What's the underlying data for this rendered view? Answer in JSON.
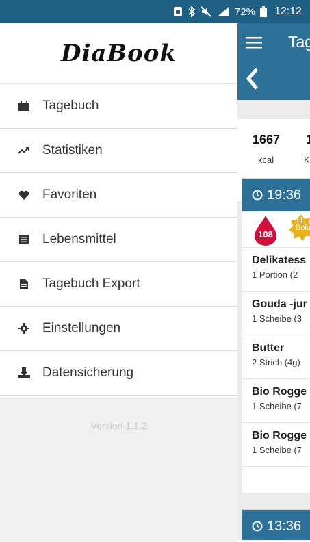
{
  "status": {
    "battery": "72%",
    "time": "12:12"
  },
  "drawer": {
    "logo": "DiaBook",
    "items": [
      {
        "label": "Tagebuch",
        "icon": "calendar-icon"
      },
      {
        "label": "Statistiken",
        "icon": "trend-icon"
      },
      {
        "label": "Favoriten",
        "icon": "heart-icon"
      },
      {
        "label": "Lebensmittel",
        "icon": "list-icon"
      },
      {
        "label": "Tagebuch Export",
        "icon": "file-icon"
      },
      {
        "label": "Einstellungen",
        "icon": "gear-icon"
      },
      {
        "label": "Datensicherung",
        "icon": "download-icon"
      }
    ],
    "version": "Version 1.1.2"
  },
  "main": {
    "title": "Tag",
    "stats": [
      {
        "value": "1667",
        "label": "kcal"
      },
      {
        "value": "1",
        "label": "K"
      }
    ],
    "entries": [
      {
        "time": "19:36",
        "glucose": "108",
        "bolus_value": "11,",
        "bolus_label": "Bolu",
        "foods": [
          {
            "name": "Delikatess",
            "amount": "1 Portion (2"
          },
          {
            "name": "Gouda -jur",
            "amount": "1 Scheibe (3"
          },
          {
            "name": "Butter",
            "amount": "2 Strich (4g)"
          },
          {
            "name": "Bio Rogge",
            "amount": "1 Scheibe (7"
          },
          {
            "name": "Bio Rogge",
            "amount": "1 Scheibe (7"
          }
        ]
      },
      {
        "time": "13:36"
      }
    ]
  },
  "colors": {
    "statusbar": "#1f5f84",
    "appbar": "#2d7199",
    "glucose_drop": "#d0103a",
    "bolus_badge": "#e7b21b"
  }
}
